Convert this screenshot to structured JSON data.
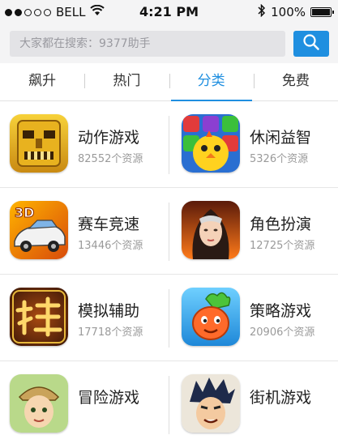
{
  "status_bar": {
    "carrier": "BELL",
    "time": "4:21 PM",
    "battery": "100%"
  },
  "search": {
    "placeholder": "大家都在搜索：9377助手",
    "button_icon": "search-icon"
  },
  "tabs": [
    {
      "label": "飙升",
      "active": false
    },
    {
      "label": "热门",
      "active": false
    },
    {
      "label": "分类",
      "active": true
    },
    {
      "label": "免费",
      "active": false
    }
  ],
  "categories": [
    {
      "title": "动作游戏",
      "count": "82552个资源",
      "icon": "temple-idol-icon"
    },
    {
      "title": "休闲益智",
      "count": "5326个资源",
      "icon": "chick-puzzle-icon"
    },
    {
      "title": "赛车竞速",
      "count": "13446个资源",
      "icon": "race-car-3d-icon"
    },
    {
      "title": "角色扮演",
      "count": "12725个资源",
      "icon": "heroine-portrait-icon"
    },
    {
      "title": "模拟辅助",
      "count": "17718个资源",
      "icon": "gua-character-icon"
    },
    {
      "title": "策略游戏",
      "count": "20906个资源",
      "icon": "radish-veggie-icon"
    },
    {
      "title": "冒险游戏",
      "count": "",
      "icon": "explorer-girl-icon"
    },
    {
      "title": "街机游戏",
      "count": "",
      "icon": "fighter-boy-icon"
    }
  ],
  "colors": {
    "accent": "#1f8fe0",
    "text_primary": "#222222",
    "text_secondary": "#9a9a9a"
  }
}
